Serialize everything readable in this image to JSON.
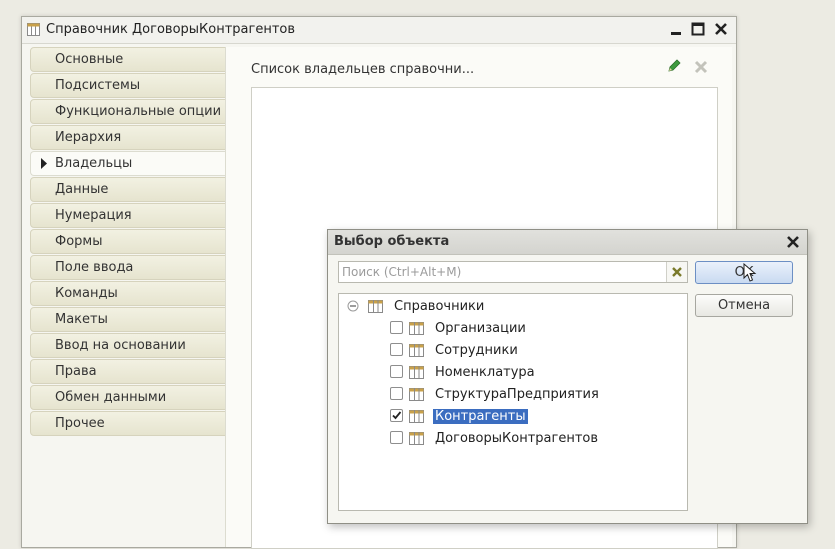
{
  "window": {
    "title": "Справочник ДоговорыКонтрагентов"
  },
  "nav": {
    "items": [
      {
        "label": "Основные"
      },
      {
        "label": "Подсистемы"
      },
      {
        "label": "Функциональные опции"
      },
      {
        "label": "Иерархия"
      },
      {
        "label": "Владельцы",
        "active": true
      },
      {
        "label": "Данные"
      },
      {
        "label": "Нумерация"
      },
      {
        "label": "Формы"
      },
      {
        "label": "Поле ввода"
      },
      {
        "label": "Команды"
      },
      {
        "label": "Макеты"
      },
      {
        "label": "Ввод на основании"
      },
      {
        "label": "Права"
      },
      {
        "label": "Обмен данными"
      },
      {
        "label": "Прочее"
      }
    ]
  },
  "content": {
    "owners_label": "Список владельцев справочни..."
  },
  "dialog": {
    "title": "Выбор объекта",
    "search_placeholder": "Поиск (Ctrl+Alt+M)",
    "ok_label": "OK",
    "cancel_label": "Отмена",
    "tree": {
      "root_label": "Справочники",
      "items": [
        {
          "label": "Организации",
          "checked": false,
          "selected": false
        },
        {
          "label": "Сотрудники",
          "checked": false,
          "selected": false
        },
        {
          "label": "Номенклатура",
          "checked": false,
          "selected": false
        },
        {
          "label": "СтруктураПредприятия",
          "checked": false,
          "selected": false
        },
        {
          "label": "Контрагенты",
          "checked": true,
          "selected": true
        },
        {
          "label": "ДоговорыКонтрагентов",
          "checked": false,
          "selected": false
        }
      ]
    }
  },
  "colors": {
    "selection": "#3b6dc0",
    "edit_icon": "#3d9a3d"
  }
}
